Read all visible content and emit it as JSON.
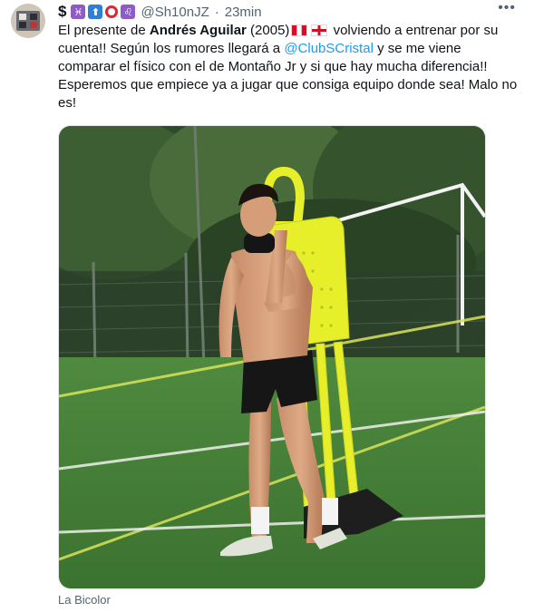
{
  "author": {
    "prefix_symbol": "$",
    "emojis": [
      "pisces-emoji",
      "up-arrow-emoji",
      "red-circle-emoji",
      "leo-emoji"
    ],
    "handle": "@Sh10nJZ",
    "separator": "·",
    "timestamp": "23min"
  },
  "tweet": {
    "t1": "El presente de ",
    "bold_name": "Andrés Aguilar",
    "t2": " (2005)",
    "t3": " volviendo a entrenar por su cuenta!! Según los rumores llegará a ",
    "mention": "@ClubSCristal",
    "t4": " y se me viene comparar el físico con el de Montaño Jr y si que hay mucha diferencia!! Esperemos que empiece ya a jugar que consiga equipo donde sea! Malo no es!"
  },
  "media": {
    "description": "photo-of-athlete-training-on-field",
    "source_label": "La Bicolor"
  },
  "menu": {
    "more_icon": "•••"
  },
  "colors": {
    "link": "#1d9bf0",
    "secondary_text": "#536471",
    "grass": "#3f7a38",
    "dummy_yellow": "#e6ef2a"
  }
}
